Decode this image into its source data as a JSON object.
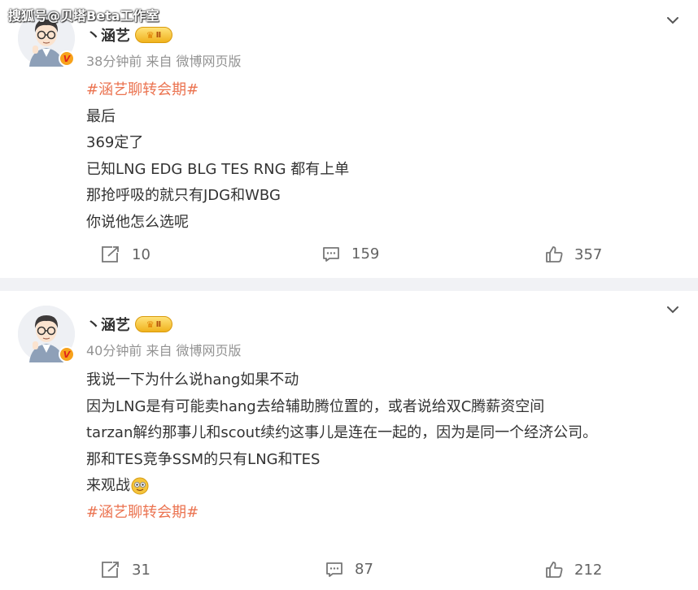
{
  "watermark": "搜狐号@贝塔Beta工作室",
  "posts": [
    {
      "user_name": "丶涵艺",
      "level_badge": "Ⅱ",
      "verified_badge": "V",
      "meta": "38分钟前  来自 微博网页版",
      "content_lines": [
        "#涵艺聊转会期#",
        "最后",
        "369定了",
        "已知LNG EDG BLG TES RNG 都有上单",
        "那抢呼吸的就只有JDG和WBG",
        "你说他怎么选呢"
      ],
      "reposts": "10",
      "comments": "159",
      "likes": "357"
    },
    {
      "user_name": "丶涵艺",
      "level_badge": "Ⅱ",
      "verified_badge": "V",
      "meta": "40分钟前  来自 微博网页版",
      "content_lines": [
        "我说一下为什么说hang如果不动",
        "因为LNG是有可能卖hang去给辅助腾位置的，或者说给双C腾薪资空间",
        "tarzan解约那事儿和scout续约这事儿是连在一起的，因为是同一个经济公司。",
        "那和TES竞争SSM的只有LNG和TES",
        "来观战",
        "",
        "#涵艺聊转会期#"
      ],
      "reposts": "31",
      "comments": "87",
      "likes": "212"
    }
  ],
  "icons": {
    "repost": "repost-icon",
    "comment": "comment-icon",
    "like": "like-icon",
    "more": "chevron-down-icon",
    "emoji": "doge-emoji-icon"
  },
  "colors": {
    "topic_tag": "#eb7350",
    "meta_text": "#939393",
    "action_text": "#636363",
    "divider": "#f1f2f5"
  }
}
